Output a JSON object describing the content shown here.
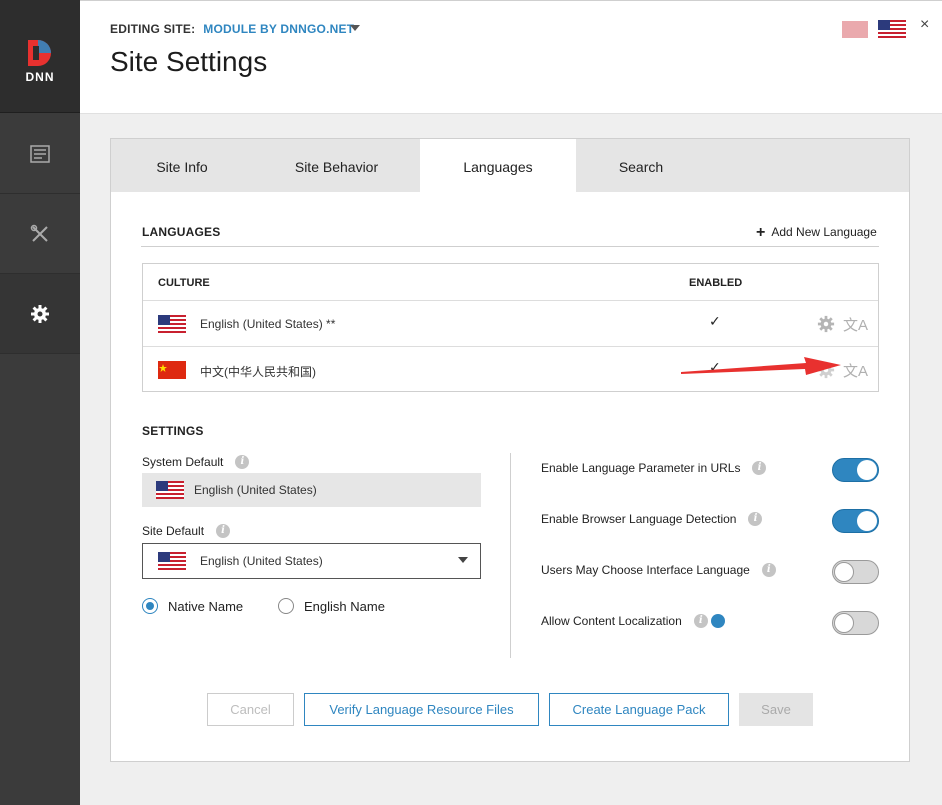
{
  "sidebar": {
    "brand": "DNN",
    "items": [
      {
        "icon": "content-icon"
      },
      {
        "icon": "tools-icon"
      },
      {
        "icon": "gear-icon",
        "active": true
      }
    ]
  },
  "header": {
    "editing_label": "EDITING SITE:",
    "site_name": "MODULE BY DNNGO.NET",
    "title": "Site Settings",
    "close": "×"
  },
  "tabs": [
    {
      "label": "Site Info",
      "active": false
    },
    {
      "label": "Site Behavior",
      "active": false
    },
    {
      "label": "Languages",
      "active": true
    },
    {
      "label": "Search",
      "active": false
    }
  ],
  "languages": {
    "section_title": "LANGUAGES",
    "add_label": "Add New Language",
    "col_culture": "CULTURE",
    "col_enabled": "ENABLED",
    "rows": [
      {
        "name": "English (United States) **",
        "enabled": "✓",
        "flag": "us"
      },
      {
        "name": "中文(中华人民共和国)",
        "enabled": "✓",
        "flag": "cn"
      }
    ]
  },
  "settings": {
    "section_title": "SETTINGS",
    "system_default_label": "System Default",
    "system_default_value": "English (United States)",
    "site_default_label": "Site Default",
    "site_default_value": "English (United States)",
    "name_options": [
      {
        "label": "Native Name",
        "selected": true
      },
      {
        "label": "English Name",
        "selected": false
      }
    ],
    "toggles": [
      {
        "label": "Enable Language Parameter in URLs",
        "on": true
      },
      {
        "label": "Enable Browser Language Detection",
        "on": true
      },
      {
        "label": "Users May Choose Interface Language",
        "on": false
      },
      {
        "label": "Allow Content Localization",
        "on": false
      }
    ]
  },
  "buttons": {
    "cancel": "Cancel",
    "verify": "Verify Language Resource Files",
    "create_pack": "Create Language Pack",
    "save": "Save"
  },
  "colors": {
    "accent": "#2f86c0",
    "sidebar": "#3b3b3b",
    "arrow": "#e8312f"
  }
}
